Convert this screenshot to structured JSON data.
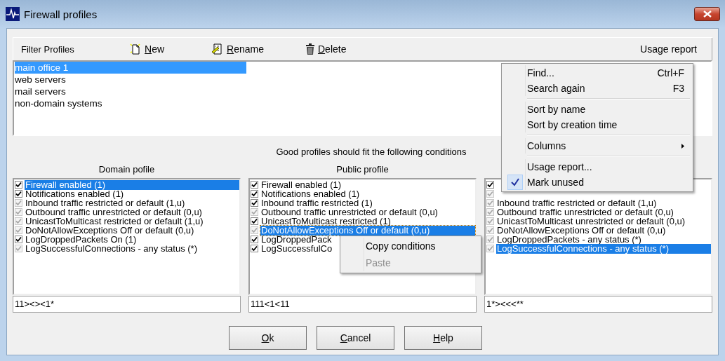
{
  "window": {
    "title": "Firewall profiles"
  },
  "toolbar": {
    "label": "Filter Profiles",
    "buttons": [
      {
        "label": "New"
      },
      {
        "label": "Rename"
      },
      {
        "label": "Delete"
      }
    ],
    "usage_report": "Usage report"
  },
  "profiles": [
    {
      "name": "main office 1",
      "selected": true
    },
    {
      "name": "web servers",
      "selected": false
    },
    {
      "name": "mail servers",
      "selected": false
    },
    {
      "name": "non-domain systems",
      "selected": false
    }
  ],
  "caption": "Good profiles should fit the following conditions",
  "columns": [
    {
      "heading": "Domain pofile",
      "code": "11><><1*",
      "items": [
        {
          "text": "Firewall enabled (1)",
          "kind": "set",
          "checked": true,
          "selected": true
        },
        {
          "text": "Notifications enabled (1)",
          "kind": "set",
          "checked": true,
          "selected": false
        },
        {
          "text": "Inbound traffic restricted or default (1,u)",
          "kind": "default",
          "checked": true,
          "selected": false
        },
        {
          "text": "Outbound traffic unrestricted or default (0,u)",
          "kind": "default",
          "checked": true,
          "selected": false
        },
        {
          "text": "UnicastToMulticast restricted or default (1,u)",
          "kind": "default",
          "checked": true,
          "selected": false
        },
        {
          "text": "DoNotAllowExceptions Off or default (0,u)",
          "kind": "default",
          "checked": true,
          "selected": false
        },
        {
          "text": "LogDroppedPackets On (1)",
          "kind": "set",
          "checked": true,
          "selected": false
        },
        {
          "text": "LogSuccessfulConnections - any status (*)",
          "kind": "default",
          "checked": true,
          "selected": false
        }
      ]
    },
    {
      "heading": "Public profile",
      "code": "111<1<11",
      "items": [
        {
          "text": "Firewall enabled (1)",
          "kind": "set",
          "checked": true,
          "selected": false
        },
        {
          "text": "Notifications enabled (1)",
          "kind": "set",
          "checked": true,
          "selected": false
        },
        {
          "text": "Inbound traffic restricted (1)",
          "kind": "set",
          "checked": true,
          "selected": false
        },
        {
          "text": "Outbound traffic unrestricted or default (0,u)",
          "kind": "default",
          "checked": true,
          "selected": false
        },
        {
          "text": "UnicastToMulticast restricted (1)",
          "kind": "set",
          "checked": true,
          "selected": false
        },
        {
          "text": "DoNotAllowExceptions Off or default (0,u)",
          "kind": "default",
          "checked": true,
          "selected": true
        },
        {
          "text": "LogDroppedPack",
          "kind": "set",
          "checked": true,
          "selected": false
        },
        {
          "text": "LogSuccessfulCo",
          "kind": "set",
          "checked": true,
          "selected": false
        }
      ]
    },
    {
      "code": "1*><<<**",
      "items": [
        {
          "kind": "set",
          "checked": true
        },
        {
          "kind": "default",
          "checked": true
        },
        {
          "text": "Inbound traffic restricted or default (1,u)",
          "kind": "default",
          "checked": true,
          "selected": false
        },
        {
          "text": "Outbound traffic unrestricted or default (0,u)",
          "kind": "default",
          "checked": true,
          "selected": false
        },
        {
          "text": "UnicastToMulticast unrestricted or default (0,u)",
          "kind": "default",
          "checked": true,
          "selected": false
        },
        {
          "text": "DoNotAllowExceptions Off or default (0,u)",
          "kind": "default",
          "checked": true,
          "selected": false
        },
        {
          "text": "LogDroppedPackets - any status (*)",
          "kind": "default",
          "checked": true,
          "selected": false
        },
        {
          "text": "LogSuccessfulConnections - any status (*)",
          "kind": "default",
          "checked": true,
          "selected": true
        }
      ]
    }
  ],
  "buttons": [
    {
      "label": "Ok"
    },
    {
      "label": "Cancel"
    },
    {
      "label": "Help"
    }
  ],
  "list_menu": [
    {
      "kind": "item",
      "label": "Find...",
      "shortcut": "Ctrl+F",
      "checked": false
    },
    {
      "kind": "item",
      "label": "Search again",
      "shortcut": "F3",
      "checked": false
    },
    {
      "kind": "separator"
    },
    {
      "kind": "item",
      "label": "Sort by name",
      "checked": false
    },
    {
      "kind": "item",
      "label": "Sort by creation time",
      "checked": false
    },
    {
      "kind": "separator"
    },
    {
      "kind": "submenu",
      "label": "Columns"
    },
    {
      "kind": "separator"
    },
    {
      "kind": "item",
      "label": "Usage report...",
      "checked": false
    },
    {
      "kind": "item",
      "label": "Mark unused",
      "checked": true
    }
  ],
  "condition_menu": [
    {
      "kind": "item",
      "label": "Copy conditions",
      "disabled": false
    },
    {
      "kind": "item",
      "label": "Paste",
      "disabled": true
    }
  ]
}
